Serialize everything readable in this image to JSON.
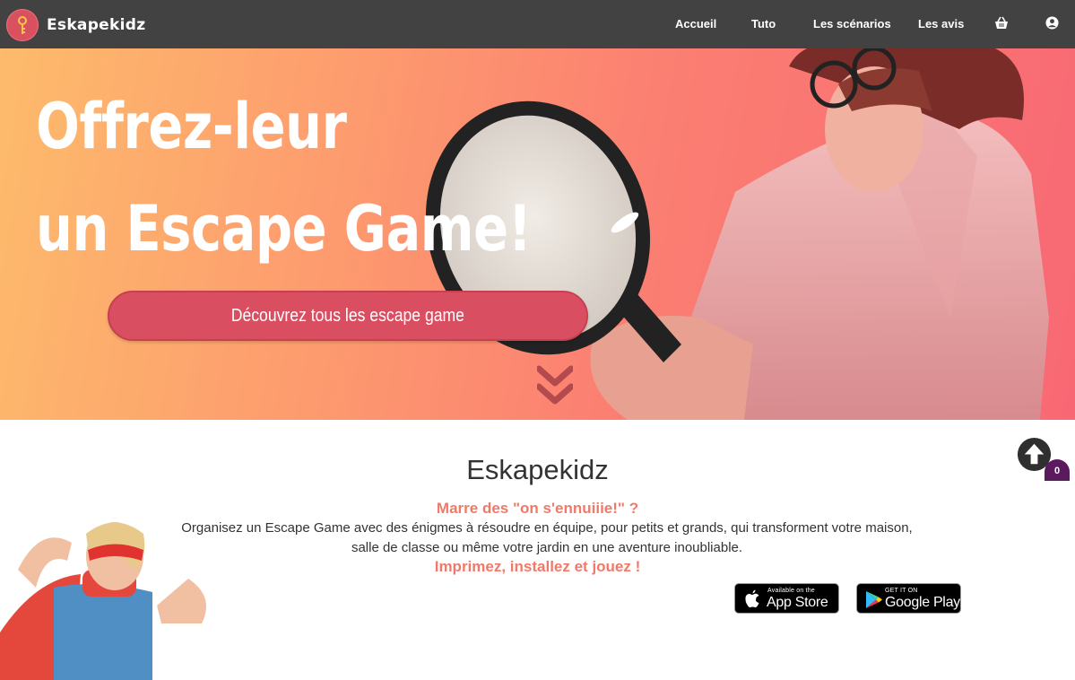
{
  "brand": {
    "name": "Eskapekidz",
    "logo_icon": "key-logo-icon",
    "logo_color": "#d9505e"
  },
  "nav": {
    "items": [
      {
        "label": "Accueil"
      },
      {
        "label": "Tuto"
      },
      {
        "label": "Les scénarios"
      },
      {
        "label": "Les avis"
      }
    ],
    "cart_icon": "basket-icon",
    "account_icon": "user-circle-icon"
  },
  "hero": {
    "title_line1": "Offrez-leur",
    "title_line2": "un Escape Game!",
    "cta_label": "Découvrez tous les escape game",
    "scroll_icon": "double-chevron-down-icon"
  },
  "intro": {
    "title": "Eskapekidz",
    "tagline1": "Marre des \"on s'ennuiiie!\" ?",
    "text_line1": "Organisez un Escape Game avec des énigmes à résoudre en équipe, pour petits et grands, qui transforment votre maison,",
    "text_line2": "salle de classe ou même votre jardin en une aventure inoubliable.",
    "tagline2": "Imprimez, installez et jouez !"
  },
  "stores": {
    "appstore": {
      "small": "Available on the",
      "big": "App Store"
    },
    "googleplay": {
      "small": "GET IT ON",
      "big": "Google Play"
    }
  },
  "widgets": {
    "cart_count": "0",
    "scroll_top_icon": "arrow-up-circle-icon"
  },
  "colors": {
    "navbar": "#424242",
    "accent": "#d94f61",
    "tagline": "#ef7a6a",
    "hero_gradient_start": "#fdbb6c",
    "hero_gradient_end": "#f86874",
    "badge_bubble": "#5b1a5e"
  }
}
